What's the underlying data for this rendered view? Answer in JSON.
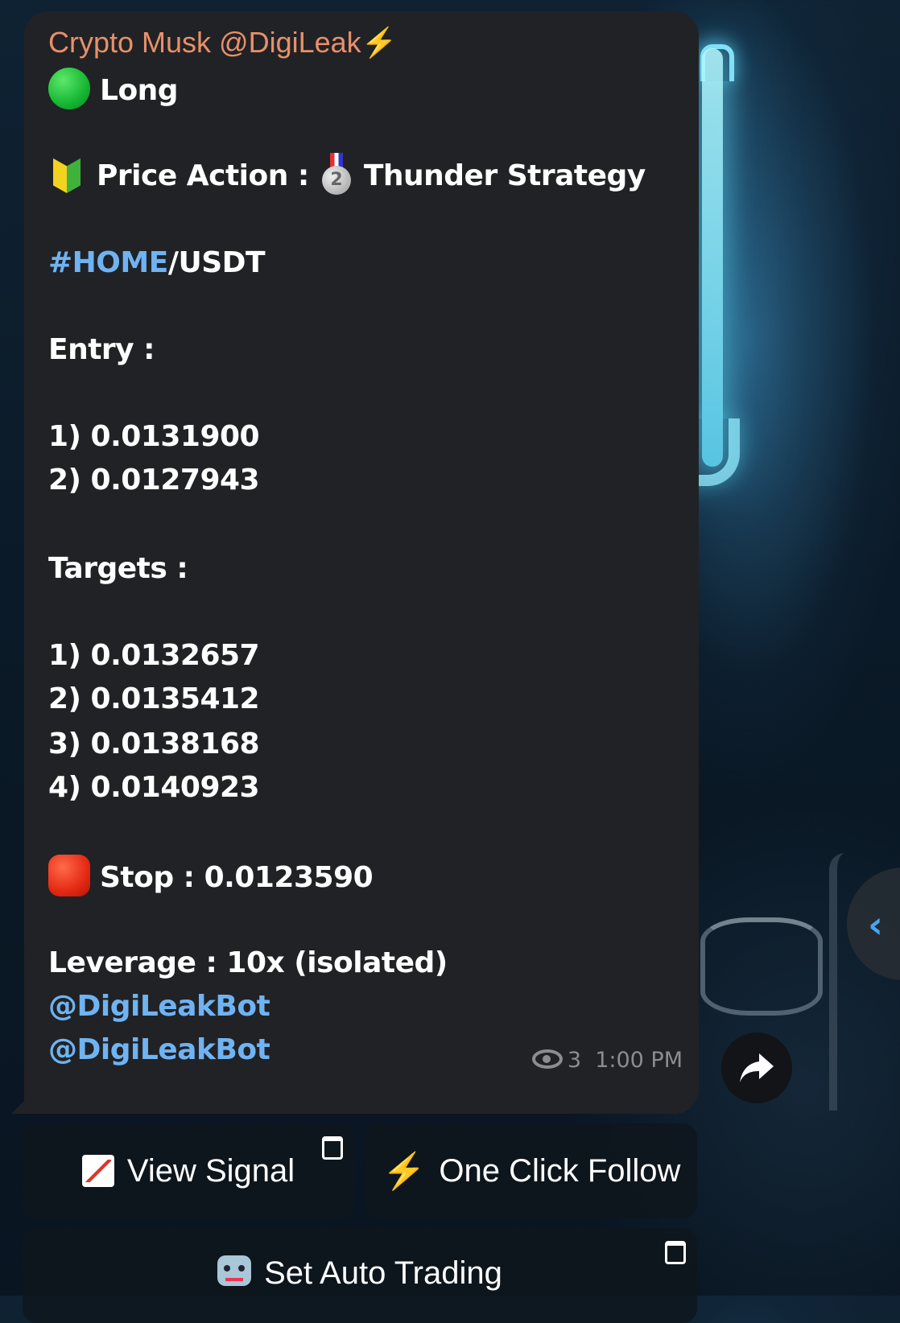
{
  "message": {
    "sender": "Crypto Musk @DigiLeak⚡",
    "direction": "Long",
    "strategy_label": "Price Action :",
    "strategy_name": "Thunder Strategy",
    "medal_number": "2",
    "pair_tag": "#HOME",
    "pair_quote": "/USDT",
    "entry_label": "Entry :",
    "entries": [
      "1) 0.0131900",
      "2) 0.0127943"
    ],
    "targets_label": "Targets :",
    "targets": [
      "1) 0.0132657",
      "2) 0.0135412",
      "3) 0.0138168",
      "4) 0.0140923"
    ],
    "stop": "Stop : 0.0123590",
    "leverage": "Leverage : 10x (isolated)",
    "bot_mentions": [
      "@DigiLeakBot",
      "@DigiLeakBot"
    ],
    "views": "3",
    "time": "1:00 PM"
  },
  "buttons": {
    "view_signal": "View Signal",
    "one_click_follow": "One Click Follow",
    "set_auto_trading": "Set Auto Trading"
  },
  "icons": {
    "direction": "green-circle-icon",
    "strategy": "beginner-leaf-icon",
    "medal": "second-place-medal-icon",
    "stop": "stop-sign-icon",
    "views": "eye-icon",
    "share": "share-arrow-icon",
    "scroll": "chevron-left-icon",
    "view_signal": "chart-up-icon",
    "one_click_follow": "lightning-icon",
    "set_auto_trading": "robot-icon"
  },
  "colors": {
    "bubble": "#212225",
    "sender": "#e8906a",
    "link": "#6fb3f2",
    "meta": "#8b8d91"
  }
}
